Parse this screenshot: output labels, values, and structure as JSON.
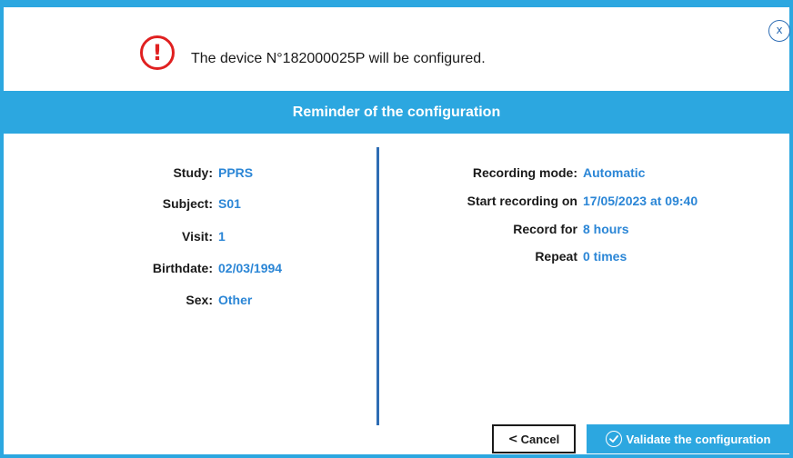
{
  "dialog": {
    "close_label": "x",
    "warning_icon": "!",
    "message": "The device N°182000025P will be configured.",
    "banner_title": "Reminder of the configuration"
  },
  "subject_info": [
    {
      "label": "Study:",
      "value": "PPRS"
    },
    {
      "label": "Subject:",
      "value": "S01"
    },
    {
      "label": "Visit:",
      "value": "1"
    },
    {
      "label": "Birthdate:",
      "value": "02/03/1994"
    },
    {
      "label": "Sex:",
      "value": "Other"
    }
  ],
  "recording_info": [
    {
      "label": "Recording mode:",
      "value": "Automatic"
    },
    {
      "label": "Start recording on",
      "value": "17/05/2023 at 09:40"
    },
    {
      "label": "Record for",
      "value": "8 hours"
    },
    {
      "label": "Repeat",
      "value": "0 times"
    }
  ],
  "buttons": {
    "cancel_chevron": "<",
    "cancel_label": "Cancel",
    "validate_label": "Validate the configuration"
  },
  "colors": {
    "accent": "#2ca7e0",
    "value_text": "#2b86d6",
    "warning": "#e02020"
  }
}
